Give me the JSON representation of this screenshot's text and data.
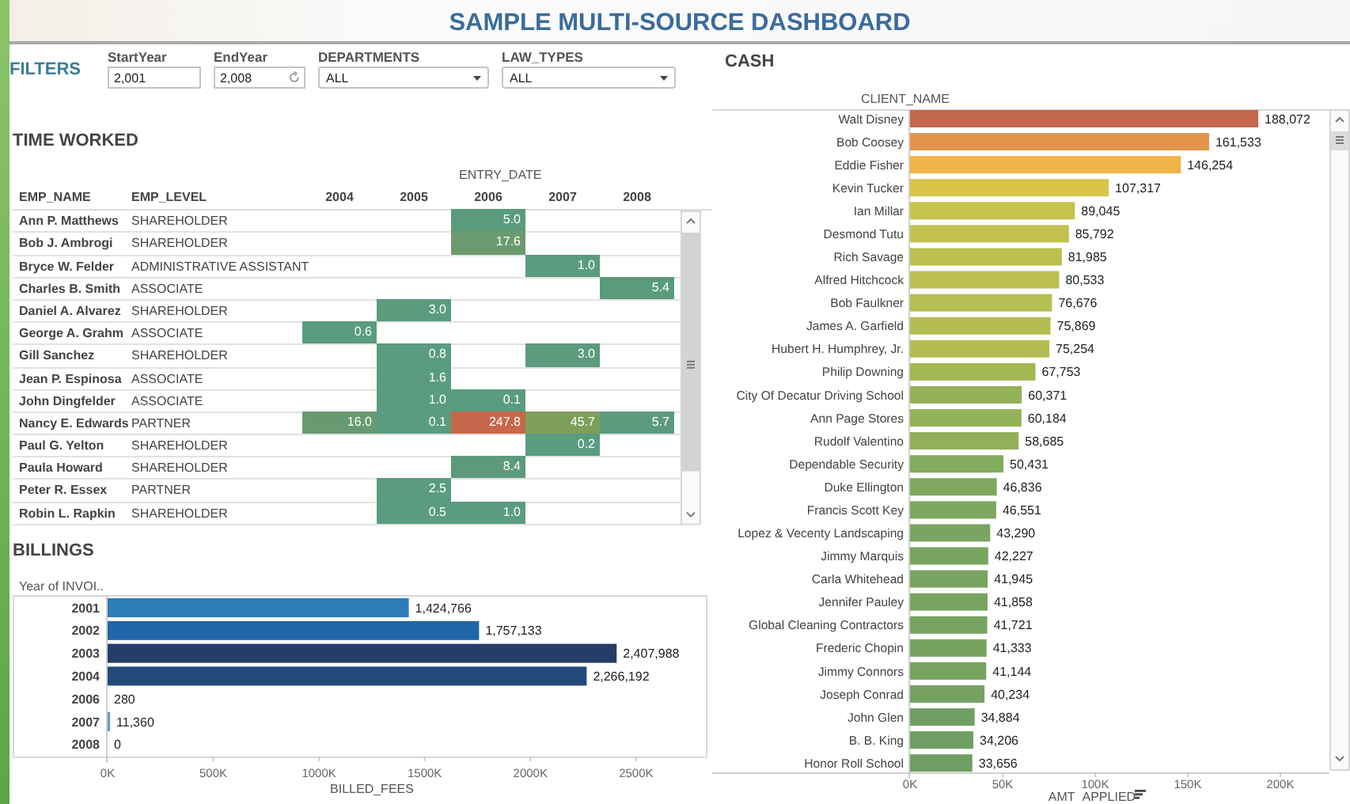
{
  "title": "SAMPLE MULTI-SOURCE DASHBOARD",
  "filters": {
    "label": "FILTERS",
    "controls": [
      {
        "kind": "field",
        "label": "StartYear",
        "value": "2,001",
        "resettable": false
      },
      {
        "kind": "field",
        "label": "EndYear",
        "value": "2,008",
        "resettable": true
      },
      {
        "kind": "dropdown",
        "label": "DEPARTMENTS",
        "value": "ALL"
      },
      {
        "kind": "dropdown",
        "label": "LAW_TYPES",
        "value": "ALL"
      }
    ]
  },
  "time_worked": {
    "title": "TIME WORKED",
    "column_group": "ENTRY_DATE",
    "columns": [
      "EMP_NAME",
      "EMP_LEVEL",
      "2004",
      "2005",
      "2006",
      "2007",
      "2008"
    ],
    "rows": [
      {
        "name": "Ann P. Matthews",
        "level": "SHAREHOLDER",
        "cells": [
          null,
          null,
          "5.0",
          null,
          null
        ]
      },
      {
        "name": "Bob J. Ambrogi",
        "level": "SHAREHOLDER",
        "cells": [
          null,
          null,
          "17.6",
          null,
          null
        ]
      },
      {
        "name": "Bryce W. Felder",
        "level": "ADMINISTRATIVE ASSISTANT",
        "cells": [
          null,
          null,
          null,
          "1.0",
          null
        ]
      },
      {
        "name": "Charles B. Smith",
        "level": "ASSOCIATE",
        "cells": [
          null,
          null,
          null,
          null,
          "5.4"
        ]
      },
      {
        "name": "Daniel A. Alvarez",
        "level": "SHAREHOLDER",
        "cells": [
          null,
          "3.0",
          null,
          null,
          null
        ]
      },
      {
        "name": "George A. Grahm",
        "level": "ASSOCIATE",
        "cells": [
          "0.6",
          null,
          null,
          null,
          null
        ]
      },
      {
        "name": "Gill Sanchez",
        "level": "SHAREHOLDER",
        "cells": [
          null,
          "0.8",
          null,
          "3.0",
          null
        ]
      },
      {
        "name": "Jean P. Espinosa",
        "level": "ASSOCIATE",
        "cells": [
          null,
          "1.6",
          null,
          null,
          null
        ]
      },
      {
        "name": "John Dingfelder",
        "level": "ASSOCIATE",
        "cells": [
          null,
          "1.0",
          "0.1",
          null,
          null
        ]
      },
      {
        "name": "Nancy E. Edwards",
        "level": "PARTNER",
        "cells": [
          "16.0",
          "0.1",
          "247.8",
          "45.7",
          "5.7"
        ]
      },
      {
        "name": "Paul G. Yelton",
        "level": "SHAREHOLDER",
        "cells": [
          null,
          null,
          null,
          "0.2",
          null
        ]
      },
      {
        "name": "Paula Howard",
        "level": "SHAREHOLDER",
        "cells": [
          null,
          null,
          "8.4",
          null,
          null
        ]
      },
      {
        "name": "Peter R. Essex",
        "level": "PARTNER",
        "cells": [
          null,
          "2.5",
          null,
          null,
          null
        ]
      },
      {
        "name": "Robin L. Rapkin",
        "level": "SHAREHOLDER",
        "cells": [
          null,
          "0.5",
          "1.0",
          null,
          null
        ]
      }
    ]
  },
  "billings": {
    "chart_data": {
      "type": "bar",
      "orientation": "horizontal",
      "title": "BILLINGS",
      "ylabel": "Year of INVOI..",
      "xlabel": "BILLED_FEES",
      "categories": [
        "2001",
        "2002",
        "2003",
        "2004",
        "2006",
        "2007",
        "2008"
      ],
      "values": [
        1424766,
        1757133,
        2407988,
        2266192,
        280,
        11360,
        0
      ],
      "data_labels": true,
      "value_labels": [
        "1,424,766",
        "1,757,133",
        "2,407,988",
        "2,266,192",
        "280",
        "11,360",
        "0"
      ],
      "xlim": [
        0,
        2830000
      ],
      "xticks": [
        {
          "value": 0,
          "label": "0K"
        },
        {
          "value": 500000,
          "label": "500K"
        },
        {
          "value": 1000000,
          "label": "1000K"
        },
        {
          "value": 1500000,
          "label": "1500K"
        },
        {
          "value": 2000000,
          "label": "2000K"
        },
        {
          "value": 2500000,
          "label": "2500K"
        }
      ]
    }
  },
  "cash": {
    "chart_data": {
      "type": "bar",
      "orientation": "horizontal",
      "title": "CASH",
      "ylabel": "CLIENT_NAME",
      "xlabel": "AMT_APPLIED",
      "categories": [
        "Walt Disney",
        "Bob Coosey",
        "Eddie Fisher",
        "Kevin Tucker",
        "Ian Millar",
        "Desmond Tutu",
        "Rich Savage",
        "Alfred Hitchcock",
        "Bob Faulkner",
        "James A. Garfield",
        "Hubert H. Humphrey, Jr.",
        "Philip Downing",
        "City Of Decatur Driving School",
        "Ann Page Stores",
        "Rudolf Valentino",
        "Dependable Security",
        "Duke Ellington",
        "Francis Scott Key",
        "Lopez & Vecenty Landscaping",
        "Jimmy Marquis",
        "Carla Whitehead",
        "Jennifer Pauley",
        "Global Cleaning Contractors",
        "Frederic Chopin",
        "Jimmy Connors",
        "Joseph Conrad",
        "John Glen",
        "B. B. King",
        "Honor Roll School"
      ],
      "values": [
        188072,
        161533,
        146254,
        107317,
        89045,
        85792,
        81985,
        80533,
        76676,
        75869,
        75254,
        67753,
        60371,
        60184,
        58685,
        50431,
        46836,
        46551,
        43290,
        42227,
        41945,
        41858,
        41721,
        41333,
        41144,
        40234,
        34884,
        34206,
        33656
      ],
      "data_labels": true,
      "value_labels": [
        "188,072",
        "161,533",
        "146,254",
        "107,317",
        "89,045",
        "85,792",
        "81,985",
        "80,533",
        "76,676",
        "75,869",
        "75,254",
        "67,753",
        "60,371",
        "60,184",
        "58,685",
        "50,431",
        "46,836",
        "46,551",
        "43,290",
        "42,227",
        "41,945",
        "41,858",
        "41,721",
        "41,333",
        "41,144",
        "40,234",
        "34,884",
        "34,206",
        "33,656"
      ],
      "xlim": [
        0,
        226500
      ],
      "xticks": [
        {
          "value": 0,
          "label": "0K"
        },
        {
          "value": 50000,
          "label": "50K"
        },
        {
          "value": 100000,
          "label": "100K"
        },
        {
          "value": 150000,
          "label": "150K"
        },
        {
          "value": 200000,
          "label": "200K"
        }
      ]
    }
  }
}
